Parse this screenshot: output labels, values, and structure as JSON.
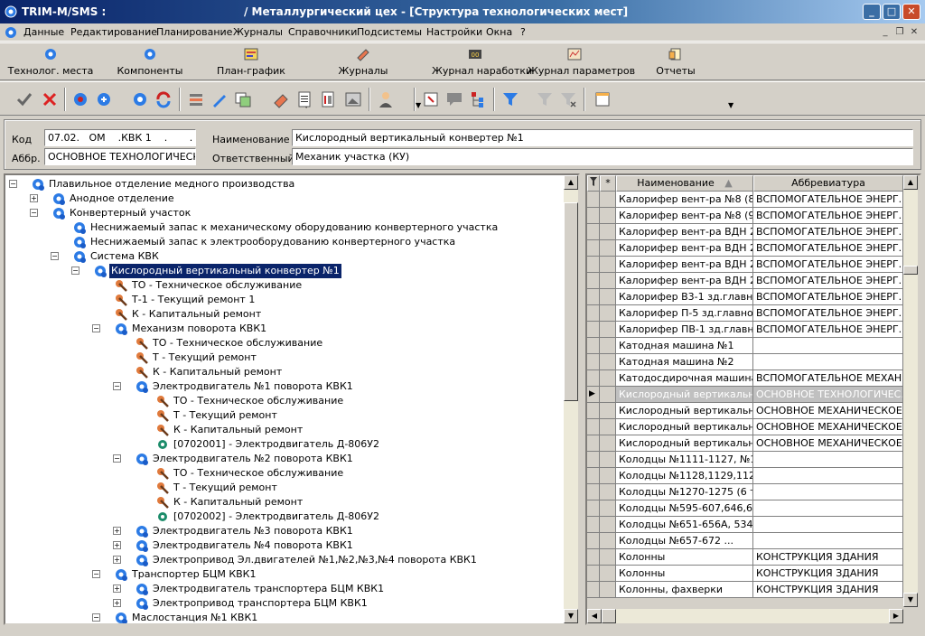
{
  "window": {
    "app": "TRIM-M/SMS :",
    "subtitle": "/ Металлургический цех - [Структура технологических мест]"
  },
  "menu": [
    "Данные",
    "Редактирование",
    "Планирование",
    "Журналы",
    "Справочники",
    "Подсистемы",
    "Настройки",
    "Окна",
    "?"
  ],
  "big_toolbar": [
    {
      "label": "Технолог. места",
      "icon": "tech-places-icon"
    },
    {
      "label": "Компоненты",
      "icon": "components-icon"
    },
    {
      "label": "План-график",
      "icon": "schedule-icon"
    },
    {
      "label": "Журналы",
      "icon": "journals-icon"
    },
    {
      "label": "Журнал наработки",
      "icon": "runtime-journal-icon"
    },
    {
      "label": "Журнал параметров",
      "icon": "params-journal-icon"
    },
    {
      "label": "Отчеты",
      "icon": "reports-icon"
    }
  ],
  "form": {
    "code_label": "Код",
    "code_value": "07.02.   ОМ    .КВК 1    .       .",
    "abbr_label": "Аббр.",
    "abbr_value": "ОСНОВНОЕ ТЕХНОЛОГИЧЕСК",
    "name_label": "Наименование",
    "name_value": "Кислородный вертикальный конвертер №1",
    "resp_label": "Ответственный",
    "resp_value": "Механик участка (КУ)"
  },
  "tree": [
    {
      "level": 0,
      "exp": "−",
      "icon": "gear",
      "text": "Плавильное отделение медного производства"
    },
    {
      "level": 1,
      "exp": "+",
      "icon": "gear",
      "text": "Анодное отделение"
    },
    {
      "level": 1,
      "exp": "−",
      "icon": "gear",
      "text": "Конвертерный участок"
    },
    {
      "level": 2,
      "exp": "",
      "icon": "gear",
      "text": "Неснижаемый запас к механическому оборудованию конвертерного участка"
    },
    {
      "level": 2,
      "exp": "",
      "icon": "gear",
      "text": "Неснижаемый запас к электрооборудованию конвертерного участка"
    },
    {
      "level": 2,
      "exp": "−",
      "icon": "gear",
      "text": "Система КВК"
    },
    {
      "level": 3,
      "exp": "−",
      "icon": "gear",
      "text": "Кислородный вертикальный конвертер №1",
      "sel": true
    },
    {
      "level": 4,
      "exp": "",
      "icon": "wrench",
      "text": "ТО - Техническое обслуживание"
    },
    {
      "level": 4,
      "exp": "",
      "icon": "wrench",
      "text": "Т-1 - Текущий ремонт 1"
    },
    {
      "level": 4,
      "exp": "",
      "icon": "wrench",
      "text": "К - Капитальный ремонт"
    },
    {
      "level": 4,
      "exp": "−",
      "icon": "gear",
      "text": "Механизм поворота КВК1"
    },
    {
      "level": 5,
      "exp": "",
      "icon": "wrench",
      "text": "ТО - Техническое обслуживание"
    },
    {
      "level": 5,
      "exp": "",
      "icon": "wrench",
      "text": "Т - Текущий ремонт"
    },
    {
      "level": 5,
      "exp": "",
      "icon": "wrench",
      "text": "К - Капитальный ремонт"
    },
    {
      "level": 5,
      "exp": "−",
      "icon": "gear",
      "text": "Электродвигатель №1 поворота КВК1"
    },
    {
      "level": 6,
      "exp": "",
      "icon": "wrench",
      "text": "ТО - Техническое обслуживание"
    },
    {
      "level": 6,
      "exp": "",
      "icon": "wrench",
      "text": "Т - Текущий ремонт"
    },
    {
      "level": 6,
      "exp": "",
      "icon": "wrench",
      "text": "К - Капитальный ремонт"
    },
    {
      "level": 6,
      "exp": "",
      "icon": "comp",
      "text": "[0702001] - Электродвигатель Д-806У2"
    },
    {
      "level": 5,
      "exp": "−",
      "icon": "gear",
      "text": "Электродвигатель №2 поворота КВК1"
    },
    {
      "level": 6,
      "exp": "",
      "icon": "wrench",
      "text": "ТО - Техническое обслуживание"
    },
    {
      "level": 6,
      "exp": "",
      "icon": "wrench",
      "text": "Т - Текущий ремонт"
    },
    {
      "level": 6,
      "exp": "",
      "icon": "wrench",
      "text": "К - Капитальный ремонт"
    },
    {
      "level": 6,
      "exp": "",
      "icon": "comp",
      "text": "[0702002] - Электродвигатель Д-806У2"
    },
    {
      "level": 5,
      "exp": "+",
      "icon": "gear",
      "text": "Электродвигатель №3 поворота КВК1"
    },
    {
      "level": 5,
      "exp": "+",
      "icon": "gear",
      "text": "Электродвигатель №4 поворота КВК1"
    },
    {
      "level": 5,
      "exp": "+",
      "icon": "gear",
      "text": "Электропривод Эл.двигателей №1,№2,№3,№4 поворота КВК1"
    },
    {
      "level": 4,
      "exp": "−",
      "icon": "gear",
      "text": "Транспортер  БЦМ КВК1"
    },
    {
      "level": 5,
      "exp": "+",
      "icon": "gear",
      "text": "Электродвигатель транспортера БЦМ КВК1"
    },
    {
      "level": 5,
      "exp": "+",
      "icon": "gear",
      "text": "Электропривод транспортера БЦМ КВК1"
    },
    {
      "level": 4,
      "exp": "−",
      "icon": "gear",
      "text": "Маслостанция №1 КВК1"
    }
  ],
  "grid": {
    "headers": {
      "filter": "",
      "star": "*",
      "name": "Наименование",
      "abbr": "Аббревиатура"
    },
    "rows": [
      {
        "name": "Калорифер  вент-ра №8 (8)...",
        "abbr": "ВСПОМОГАТЕЛЬНОЕ ЭНЕРГ..."
      },
      {
        "name": "Калорифер  вент-ра №8 (9)...",
        "abbr": "ВСПОМОГАТЕЛЬНОЕ ЭНЕРГ..."
      },
      {
        "name": "Калорифер  вент-ра ВДН 2...",
        "abbr": "ВСПОМОГАТЕЛЬНОЕ ЭНЕРГ..."
      },
      {
        "name": "Калорифер  вент-ра ВДН 2...",
        "abbr": "ВСПОМОГАТЕЛЬНОЕ ЭНЕРГ..."
      },
      {
        "name": "Калорифер  вент-ра ВДН 2...",
        "abbr": "ВСПОМОГАТЕЛЬНОЕ ЭНЕРГ..."
      },
      {
        "name": "Калорифер  вент-ра ВДН 2...",
        "abbr": "ВСПОМОГАТЕЛЬНОЕ ЭНЕРГ..."
      },
      {
        "name": "Калорифер В3-1 зд.главно...",
        "abbr": "ВСПОМОГАТЕЛЬНОЕ ЭНЕРГ..."
      },
      {
        "name": "Калорифер П-5 зд.главног...",
        "abbr": "ВСПОМОГАТЕЛЬНОЕ ЭНЕРГ..."
      },
      {
        "name": "Калорифер ПВ-1 зд.главно...",
        "abbr": "ВСПОМОГАТЕЛЬНОЕ ЭНЕРГ..."
      },
      {
        "name": "Катодная машина №1",
        "abbr": ""
      },
      {
        "name": "Катодная машина №2",
        "abbr": ""
      },
      {
        "name": "Катодосдирочная машина ...",
        "abbr": "ВСПОМОГАТЕЛЬНОЕ МЕХАН..."
      },
      {
        "name": "Кислородный вертикальн...",
        "abbr": "ОСНОВНОЕ ТЕХНОЛОГИЧЕС...",
        "cur": true
      },
      {
        "name": "Кислородный вертикальн...",
        "abbr": "ОСНОВНОЕ МЕХАНИЧЕСКОЕ..."
      },
      {
        "name": "Кислородный вертикальн...",
        "abbr": "ОСНОВНОЕ МЕХАНИЧЕСКОЕ..."
      },
      {
        "name": "Кислородный вертикальн...",
        "abbr": "ОСНОВНОЕ МЕХАНИЧЕСКОЕ..."
      },
      {
        "name": "Колодцы №1111-1127, №1...",
        "abbr": ""
      },
      {
        "name": "Колодцы №1128,1129,1129...",
        "abbr": ""
      },
      {
        "name": "Колодцы №1270-1275 (6 тш.)",
        "abbr": ""
      },
      {
        "name": "Колодцы №595-607,646,64...",
        "abbr": ""
      },
      {
        "name": "Колодцы №651-656А, 534,...",
        "abbr": ""
      },
      {
        "name": "Колодцы №657-672         ...",
        "abbr": ""
      },
      {
        "name": "Колонны",
        "abbr": "КОНСТРУКЦИЯ ЗДАНИЯ"
      },
      {
        "name": "Колонны",
        "abbr": "КОНСТРУКЦИЯ ЗДАНИЯ"
      },
      {
        "name": "Колонны, фахверки",
        "abbr": "КОНСТРУКЦИЯ ЗДАНИЯ"
      }
    ]
  }
}
